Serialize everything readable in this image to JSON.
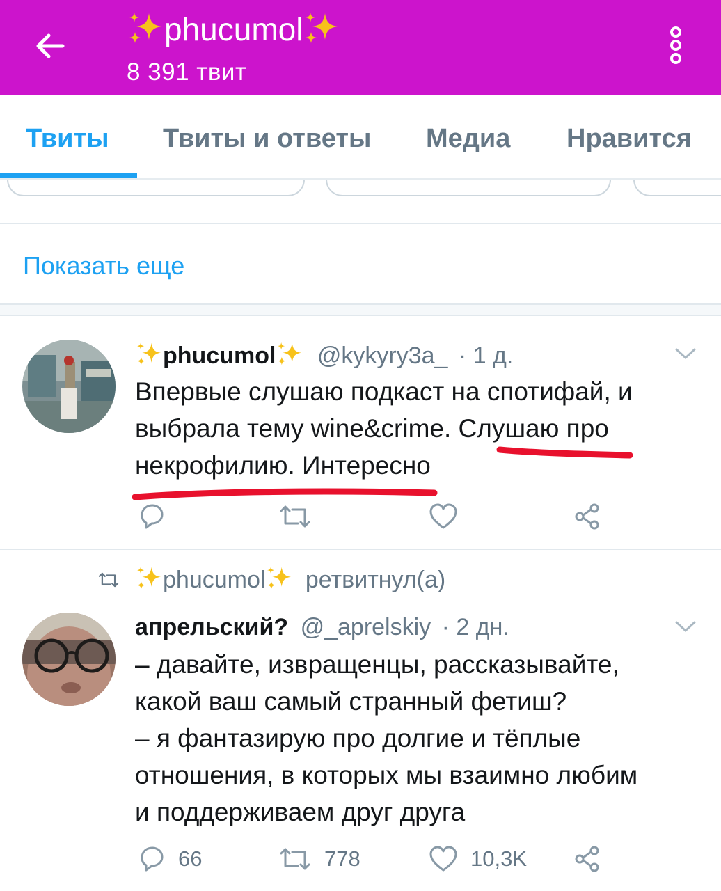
{
  "header": {
    "title": "phucumol",
    "subtitle": "8 391 твит",
    "bg_color": "#cc14cc"
  },
  "tabs": [
    {
      "label": "Твиты",
      "active": true
    },
    {
      "label": "Твиты и ответы",
      "active": false
    },
    {
      "label": "Медиа",
      "active": false
    },
    {
      "label": "Нравится",
      "active": false
    }
  ],
  "show_more": "Показать еще",
  "tweet1": {
    "name": "phucumol",
    "handle": "@kykyry3a_",
    "time": "· 1 д.",
    "lines": [
      "Впервые слушаю подкаст на спотифай, и",
      "выбрала тему wine&crime. Слушаю про",
      "некрофилию. Интересно"
    ],
    "annotation_color": "#e8112d"
  },
  "retweet_notice": {
    "name": "phucumol",
    "text": "ретвитнул(а)"
  },
  "tweet2": {
    "name": "апрельский?",
    "handle": "@_aprelskiy",
    "time": "· 2 дн.",
    "lines": [
      "– давайте, извращенцы, рассказывайте,",
      "какой ваш самый странный фетиш?",
      "– я фантазирую про долгие и тёплые",
      "отношения, в которых мы взаимно любим",
      "и поддерживаем друг друга"
    ],
    "replies": "66",
    "retweets": "778",
    "likes": "10,3K"
  },
  "icons": {
    "back": "arrow-left-icon",
    "more": "more-vertical-icon",
    "sparkle": "sparkles-emoji",
    "reply": "reply-icon",
    "retweet": "retweet-icon",
    "like": "heart-icon",
    "share": "share-icon",
    "caret": "chevron-down-icon"
  }
}
